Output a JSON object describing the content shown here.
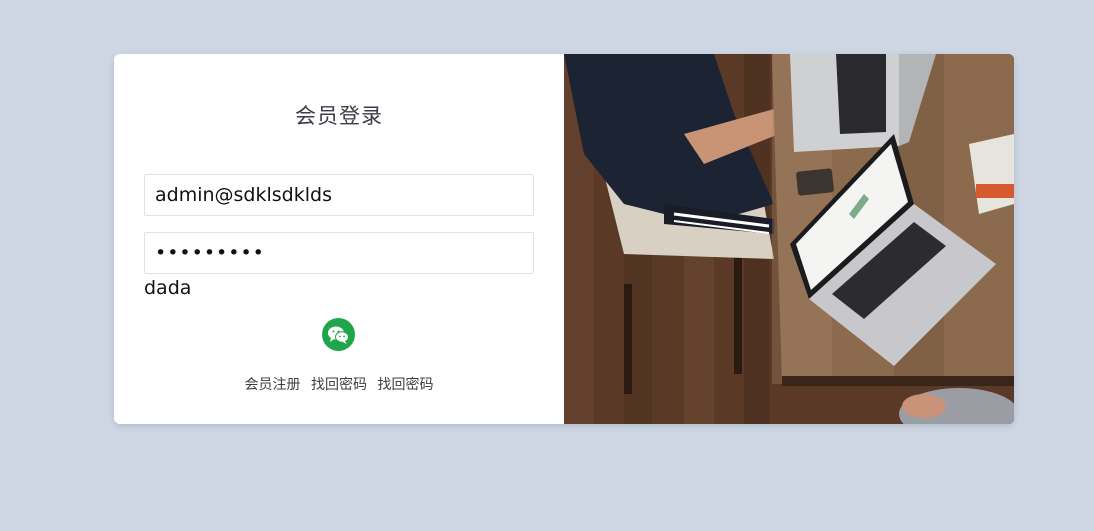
{
  "login": {
    "title": "会员登录",
    "username_value": "admin@sdklsdklds",
    "password_value": "dadadadad",
    "extra_text": "dada",
    "wechat_icon": "wechat-icon",
    "links": {
      "register": "会员注册",
      "find_password_1": "找回密码",
      "find_password_2": "找回密码"
    }
  },
  "colors": {
    "page_background": "#cdd6e2",
    "card_background": "#ffffff",
    "wechat_green": "#1fa64a",
    "title_text": "#3c3c48"
  },
  "photo": {
    "subject": "laptop-desk-photo"
  }
}
